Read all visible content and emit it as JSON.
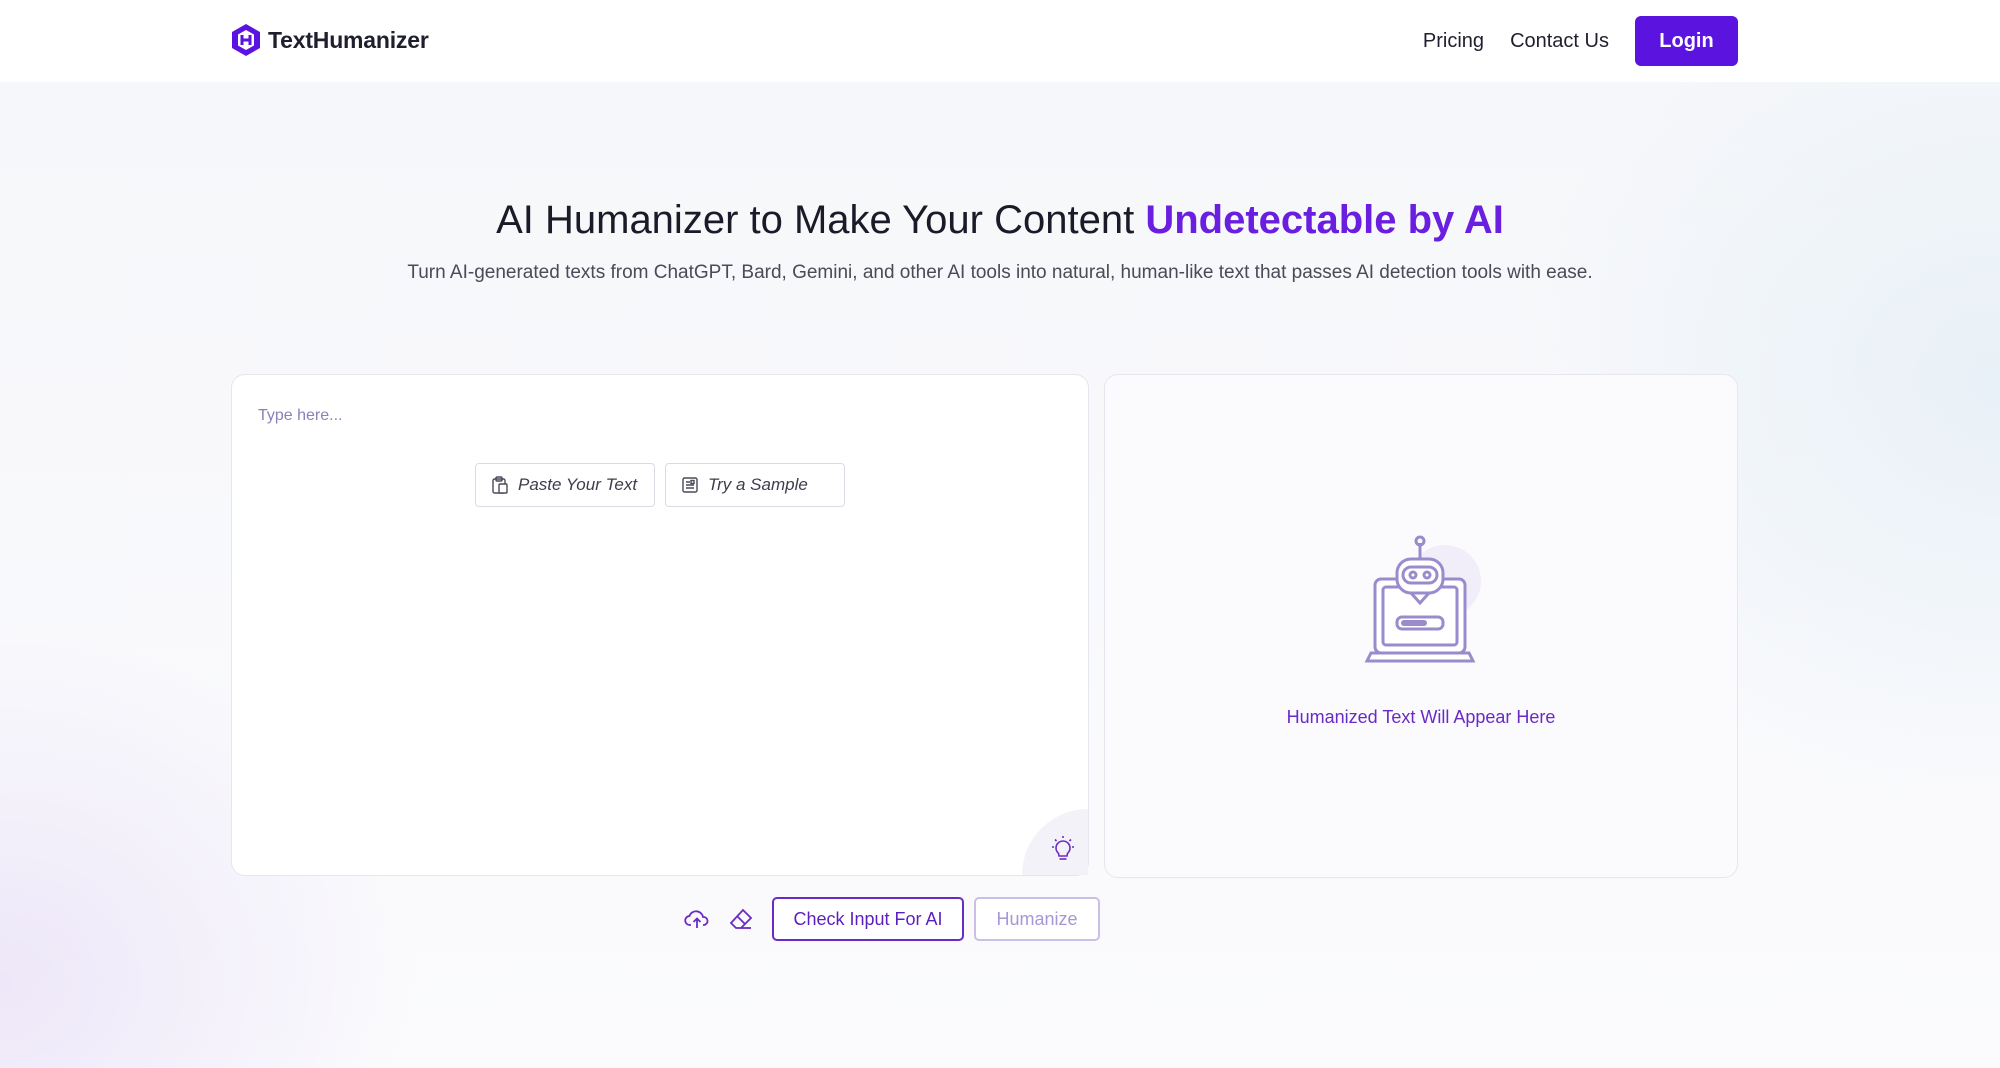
{
  "header": {
    "brand_name": "TextHumanizer",
    "nav": [
      {
        "label": "Pricing"
      },
      {
        "label": "Contact Us"
      }
    ],
    "login_label": "Login"
  },
  "hero": {
    "title_main": "AI Humanizer to Make Your Content ",
    "title_accent": "Undetectable by AI",
    "subtitle": "Turn AI-generated texts from ChatGPT, Bard, Gemini, and other AI tools into natural, human-like text that passes AI detection tools with ease."
  },
  "input": {
    "placeholder": "Type here...",
    "paste_label": "Paste Your Text",
    "sample_label": "Try a Sample"
  },
  "output": {
    "message": "Humanized Text Will Appear Here"
  },
  "toolbar": {
    "check_label": "Check Input For AI",
    "humanize_label": "Humanize"
  },
  "icons": {
    "brand": "texthumanizer-logo-icon",
    "paste": "clipboard-icon",
    "sample": "document-icon",
    "hint": "lightbulb-icon",
    "output_placeholder": "robot-laptop-icon",
    "upload": "cloud-upload-icon",
    "clear": "eraser-icon"
  },
  "colors": {
    "brand_purple": "#5b14e0",
    "accent_purple": "#6a1fe0",
    "muted_purple": "#a896d6"
  }
}
